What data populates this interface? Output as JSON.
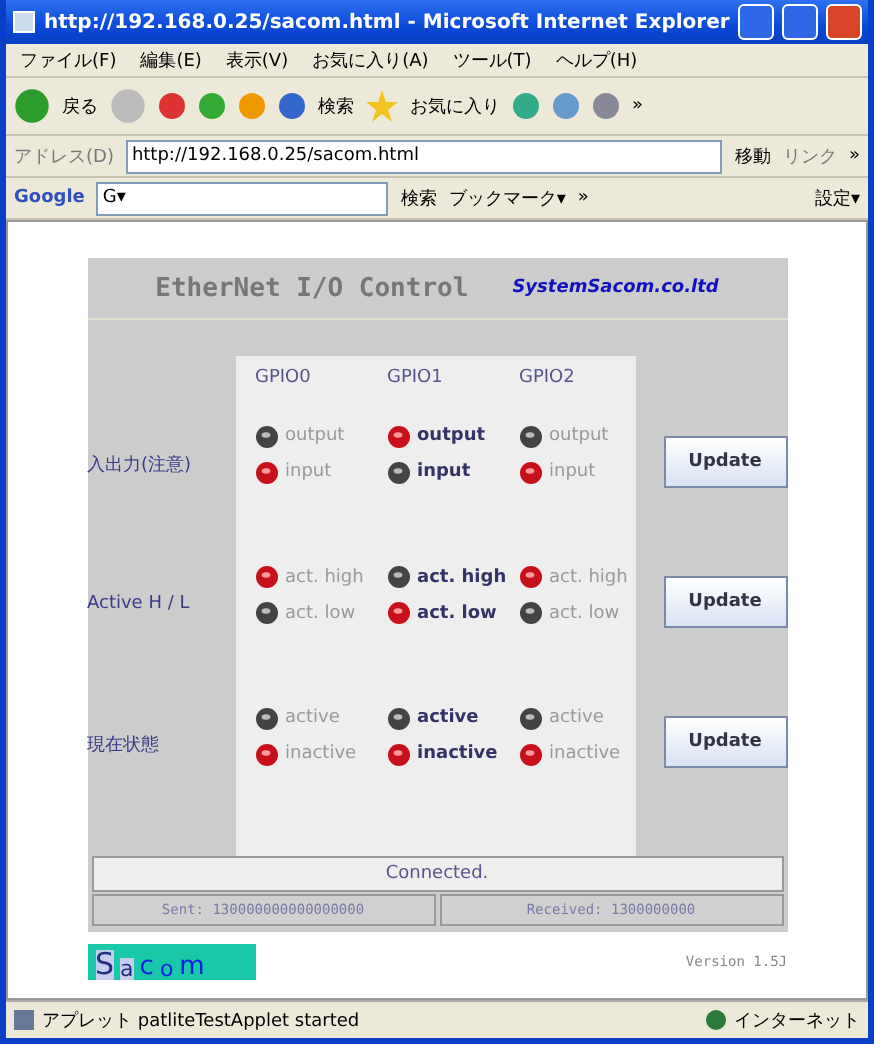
{
  "window": {
    "title": "http://192.168.0.25/sacom.html - Microsoft Internet Explorer"
  },
  "menu": [
    "ファイル(F)",
    "編集(E)",
    "表示(V)",
    "お気に入り(A)",
    "ツール(T)",
    "ヘルプ(H)"
  ],
  "toolbar": {
    "back": "戻る",
    "search": "検索",
    "favorites": "お気に入り",
    "more": "»"
  },
  "address": {
    "label": "アドレス(D)",
    "url": "http://192.168.0.25/sacom.html",
    "go": "移動",
    "links": "リンク",
    "more": "»"
  },
  "google": {
    "logo": "Google",
    "g": "G▾",
    "search": "検索",
    "bookmarks": "ブックマーク▾",
    "more": "»",
    "settings": "設定▾"
  },
  "panel": {
    "title": "EtherNet I/O Control",
    "company": "SystemSacom.co.ltd",
    "columns": [
      {
        "name": "GPIO0",
        "enabled": false
      },
      {
        "name": "GPIO1",
        "enabled": true
      },
      {
        "name": "GPIO2",
        "enabled": false
      }
    ],
    "rows": [
      {
        "label": "入出力(注意)",
        "button": "Update",
        "options": [
          [
            {
              "label": "output",
              "on": false
            },
            {
              "label": "input",
              "on": true
            }
          ],
          [
            {
              "label": "output",
              "on": true
            },
            {
              "label": "input",
              "on": false
            }
          ],
          [
            {
              "label": "output",
              "on": false
            },
            {
              "label": "input",
              "on": true
            }
          ]
        ]
      },
      {
        "label": "Active H / L",
        "button": "Update",
        "options": [
          [
            {
              "label": "act. high",
              "on": true
            },
            {
              "label": "act. low",
              "on": false
            }
          ],
          [
            {
              "label": "act. high",
              "on": false
            },
            {
              "label": "act. low",
              "on": true
            }
          ],
          [
            {
              "label": "act. high",
              "on": true
            },
            {
              "label": "act. low",
              "on": false
            }
          ]
        ]
      },
      {
        "label": "現在状態",
        "button": "Update",
        "options": [
          [
            {
              "label": "active",
              "on": false
            },
            {
              "label": "inactive",
              "on": true
            }
          ],
          [
            {
              "label": "active",
              "on": false
            },
            {
              "label": "inactive",
              "on": true
            }
          ],
          [
            {
              "label": "active",
              "on": false
            },
            {
              "label": "inactive",
              "on": true
            }
          ]
        ]
      }
    ],
    "status": "Connected.",
    "sent": "Sent: 130000000000000000",
    "received": "Received: 1300000000"
  },
  "logo": [
    "S",
    "a",
    "c",
    "o",
    "m"
  ],
  "version": "Version 1.5J",
  "status_bar": {
    "text": "アプレット patliteTestApplet started",
    "zone": "インターネット"
  }
}
